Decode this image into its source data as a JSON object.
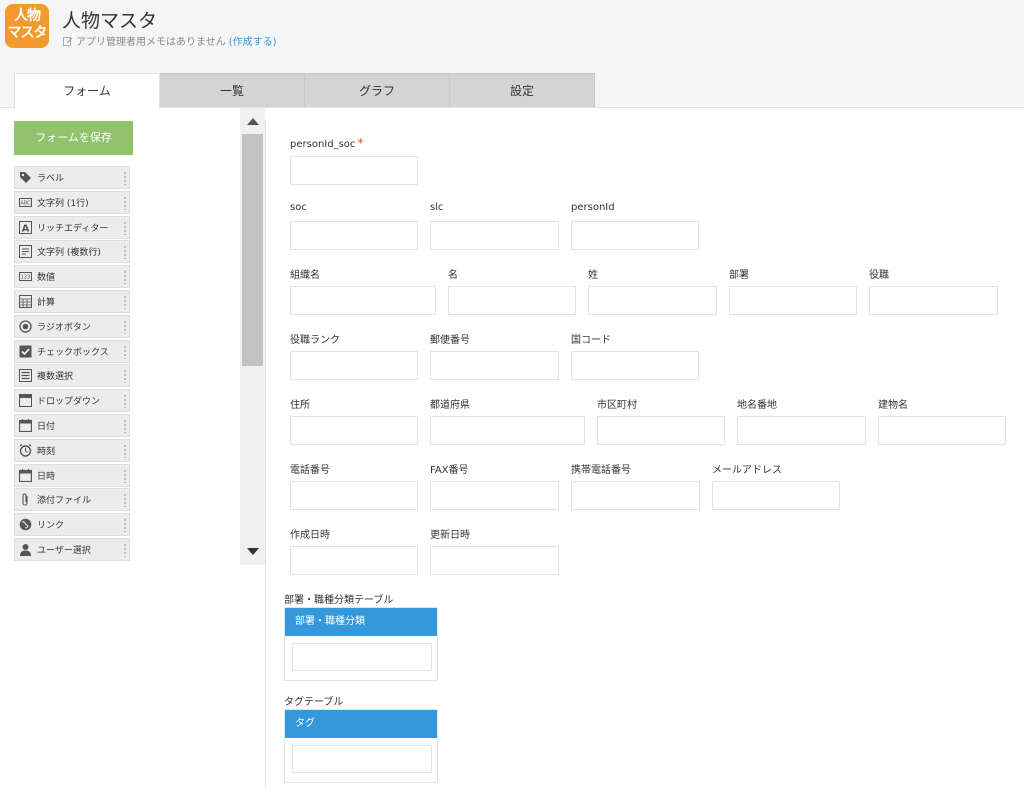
{
  "app": {
    "icon_text": "人物マスタ",
    "title": "人物マスタ",
    "memo_text": "アプリ管理者用メモはありません",
    "memo_link": "(作成する)"
  },
  "tabs": [
    "フォーム",
    "一覧",
    "グラフ",
    "設定"
  ],
  "palette": {
    "save_label": "フォームを保存",
    "items": [
      {
        "label": "ラベル",
        "icon": "tag-icon"
      },
      {
        "label": "文字列 (1行)",
        "icon": "abc-icon"
      },
      {
        "label": "リッチエディター",
        "icon": "rich-text-icon"
      },
      {
        "label": "文字列 (複数行)",
        "icon": "multiline-icon"
      },
      {
        "label": "数値",
        "icon": "number-icon"
      },
      {
        "label": "計算",
        "icon": "calculator-icon"
      },
      {
        "label": "ラジオボタン",
        "icon": "radio-icon"
      },
      {
        "label": "チェックボックス",
        "icon": "checkbox-icon"
      },
      {
        "label": "複数選択",
        "icon": "multi-select-icon"
      },
      {
        "label": "ドロップダウン",
        "icon": "dropdown-icon"
      },
      {
        "label": "日付",
        "icon": "calendar-icon"
      },
      {
        "label": "時刻",
        "icon": "clock-icon"
      },
      {
        "label": "日時",
        "icon": "datetime-icon"
      },
      {
        "label": "添付ファイル",
        "icon": "paperclip-icon"
      },
      {
        "label": "リンク",
        "icon": "globe-icon"
      },
      {
        "label": "ユーザー選択",
        "icon": "user-icon"
      }
    ]
  },
  "form": {
    "personId_soc": "personId_soc",
    "soc": "soc",
    "slc": "slc",
    "personId": "personId",
    "org": "組織名",
    "first_name": "名",
    "last_name": "姓",
    "dept": "部署",
    "position": "役職",
    "position_rank": "役職ランク",
    "postal": "郵便番号",
    "country": "国コード",
    "address": "住所",
    "prefecture": "都道府県",
    "city": "市区町村",
    "street": "地名番地",
    "building": "建物名",
    "phone": "電話番号",
    "fax": "FAX番号",
    "mobile": "携帯電話番号",
    "email": "メールアドレス",
    "created": "作成日時",
    "updated": "更新日時",
    "table1_label": "部署・職種分類テーブル",
    "table1_col": "部署・職種分類",
    "table2_label": "タグテーブル",
    "table2_col": "タグ"
  },
  "colors": {
    "accent": "#3498db",
    "save": "#91c36c",
    "app_icon": "#f29a2e",
    "required": "#e74c3c"
  }
}
